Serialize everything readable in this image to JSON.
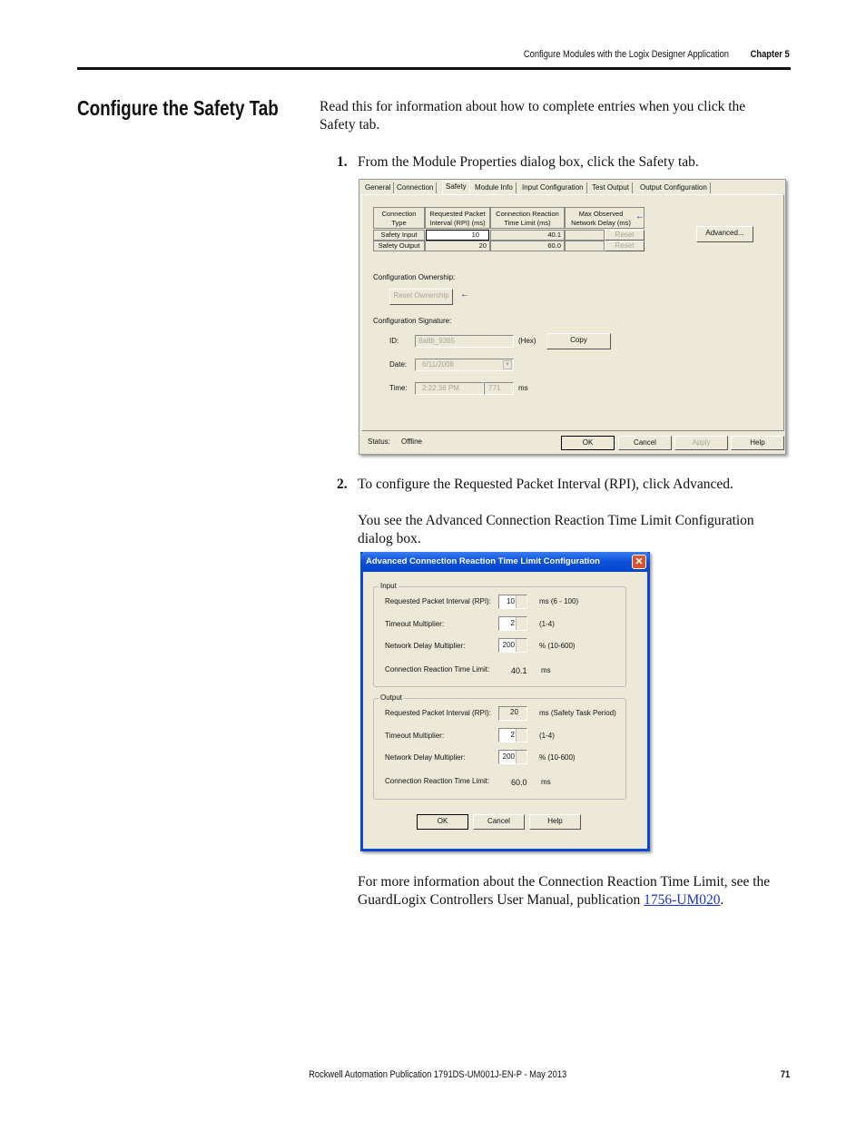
{
  "header": {
    "section": "Configure Modules with the Logix Designer Application",
    "chapter": "Chapter 5"
  },
  "title": "Configure the Safety Tab",
  "intro": "Read this for information about how to complete entries when you click the Safety tab.",
  "steps": [
    {
      "num": "1.",
      "text": "From the Module Properties dialog box, click the Safety tab."
    },
    {
      "num": "2.",
      "text": "To configure the Requested Packet Interval (RPI), click Advanced."
    }
  ],
  "step2_followup": "You see the Advanced Connection Reaction Time Limit Configuration dialog box.",
  "closing": {
    "text": "For more information about the Connection Reaction Time Limit, see the GuardLogix Controllers User Manual, publication ",
    "link": "1756-UM020",
    "end": "."
  },
  "footer": {
    "publication": "Rockwell Automation Publication 1791DS-UM001J-EN-P - May 2013",
    "page": "71"
  },
  "module_dialog": {
    "tabs": [
      "General",
      "Connection",
      "Safety",
      "Module Info",
      "Input Configuration",
      "Test Output",
      "Output Configuration"
    ],
    "active_tab": "Safety",
    "table": {
      "headers": [
        "Connection Type",
        "Requested Packet Interval (RPI) (ms)",
        "Connection Reaction Time Limit (ms)",
        "Max Observed Network Delay (ms)"
      ],
      "rows": [
        {
          "type": "Safety Input",
          "rpi": "10",
          "limit": "40.1",
          "delay": "",
          "reset": "Reset"
        },
        {
          "type": "Safety Output",
          "rpi": "20",
          "limit": "60.0",
          "delay": "",
          "reset": "Reset"
        }
      ]
    },
    "advanced_button": "Advanced...",
    "ownership_label": "Configuration Ownership:",
    "reset_ownership": "Reset Ownership",
    "signature_label": "Configuration Signature:",
    "id_label": "ID:",
    "id_value": "8a8b_9365",
    "hex": "(Hex)",
    "copy": "Copy",
    "date_label": "Date:",
    "date_value": "6/11/2008",
    "time_label": "Time:",
    "time_value": "2:22:36 PM",
    "ms_value": "771",
    "ms": "ms",
    "status_label": "Status:",
    "status_value": "Offline",
    "buttons": {
      "ok": "OK",
      "cancel": "Cancel",
      "apply": "Apply",
      "help": "Help"
    }
  },
  "advanced_dialog": {
    "title": "Advanced Connection Reaction Time Limit Configuration",
    "input": {
      "legend": "Input",
      "rpi_label": "Requested Packet Interval (RPI):",
      "rpi": "10",
      "rpi_range": "ms (6 - 100)",
      "tm_label": "Timeout Multiplier:",
      "tm": "2",
      "tm_range": "(1-4)",
      "nd_label": "Network Delay Multiplier:",
      "nd": "200",
      "nd_range": "% (10-600)",
      "crtl_label": "Connection Reaction Time Limit:",
      "crtl": "40.1",
      "unit": "ms"
    },
    "output": {
      "legend": "Output",
      "rpi_label": "Requested Packet Interval (RPI):",
      "rpi": "20",
      "rpi_range": "ms (Safety Task Period)",
      "tm_label": "Timeout Multiplier:",
      "tm": "2",
      "tm_range": "(1-4)",
      "nd_label": "Network Delay Multiplier:",
      "nd": "200",
      "nd_range": "% (10-600)",
      "crtl_label": "Connection Reaction Time Limit:",
      "crtl": "60.0",
      "unit": "ms"
    },
    "buttons": {
      "ok": "OK",
      "cancel": "Cancel",
      "help": "Help"
    }
  }
}
